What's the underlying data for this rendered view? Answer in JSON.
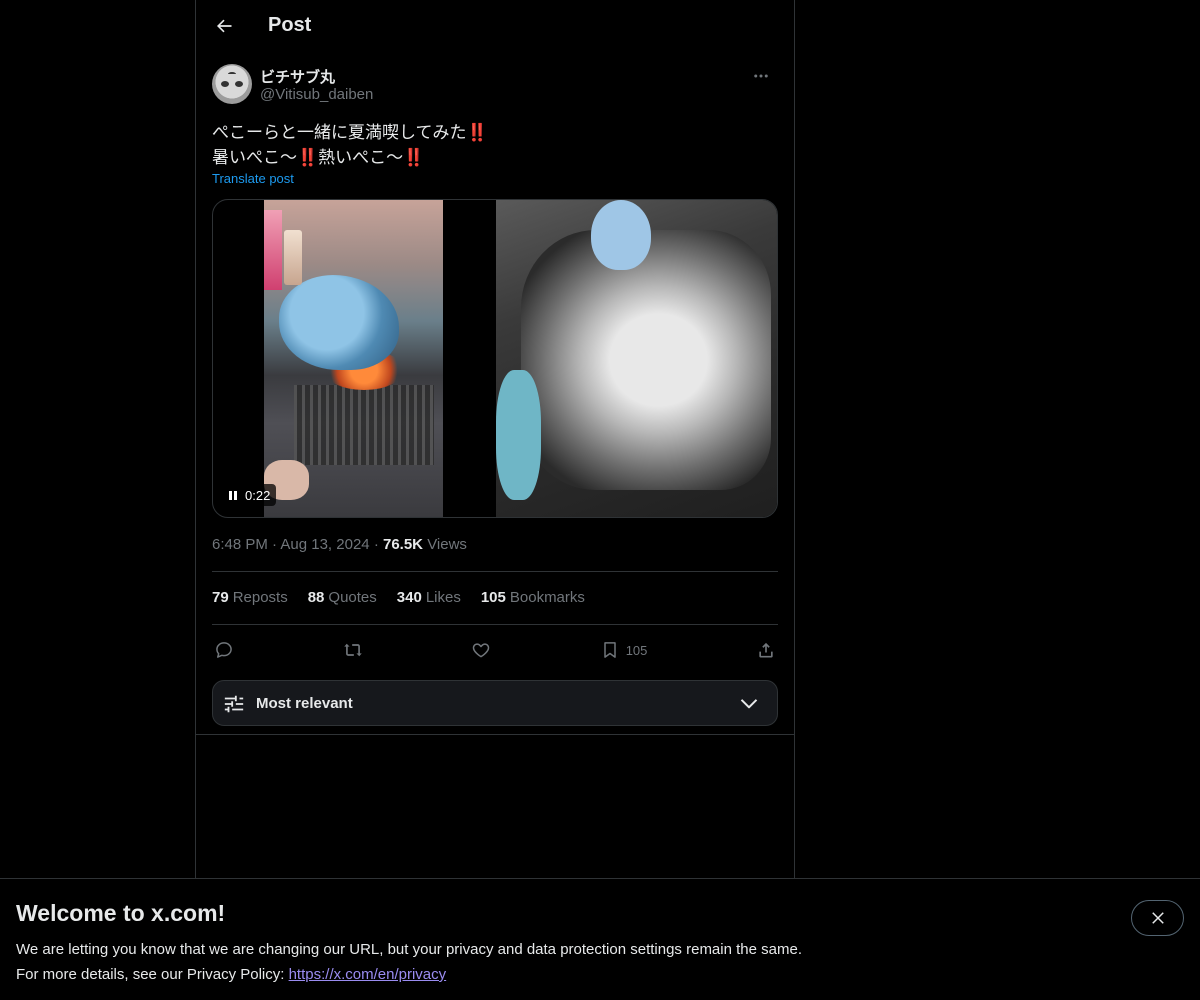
{
  "header": {
    "title": "Post"
  },
  "author": {
    "display_name": "ビチサブ丸",
    "handle": "@Vitisub_daiben"
  },
  "post": {
    "line1": "ぺこーらと一緒に夏満喫してみた",
    "line2a": "暑いぺこ～",
    "line2b": "熱いぺこ～",
    "emphasis": "‼️",
    "translate_label": "Translate post"
  },
  "media": {
    "timer": "0:22"
  },
  "meta": {
    "time": "6:48 PM",
    "sep": "·",
    "date": "Aug 13, 2024",
    "views_count": "76.5K",
    "views_label": "Views"
  },
  "stats": [
    {
      "count": "79",
      "label": "Reposts"
    },
    {
      "count": "88",
      "label": "Quotes"
    },
    {
      "count": "340",
      "label": "Likes"
    },
    {
      "count": "105",
      "label": "Bookmarks"
    }
  ],
  "actions": {
    "bookmark_count": "105"
  },
  "sort": {
    "label": "Most relevant"
  },
  "banner": {
    "title": "Welcome to x.com!",
    "line1": "We are letting you know that we are changing our URL, but your privacy and data protection settings remain the same.",
    "line2_prefix": "For more details, see our Privacy Policy: ",
    "link": "https://x.com/en/privacy"
  },
  "colors": {
    "background": "#000000",
    "text": "#e7e9ea",
    "muted": "#71767b",
    "accent": "#1d9bf0",
    "border": "#2f3336",
    "link_banner": "#9a8cf0"
  },
  "icons": [
    "back-arrow-icon",
    "more-icon",
    "pause-icon",
    "reply-icon",
    "repost-icon",
    "like-icon",
    "bookmark-icon",
    "share-icon",
    "filter-icon",
    "chevron-down-icon",
    "close-icon"
  ]
}
